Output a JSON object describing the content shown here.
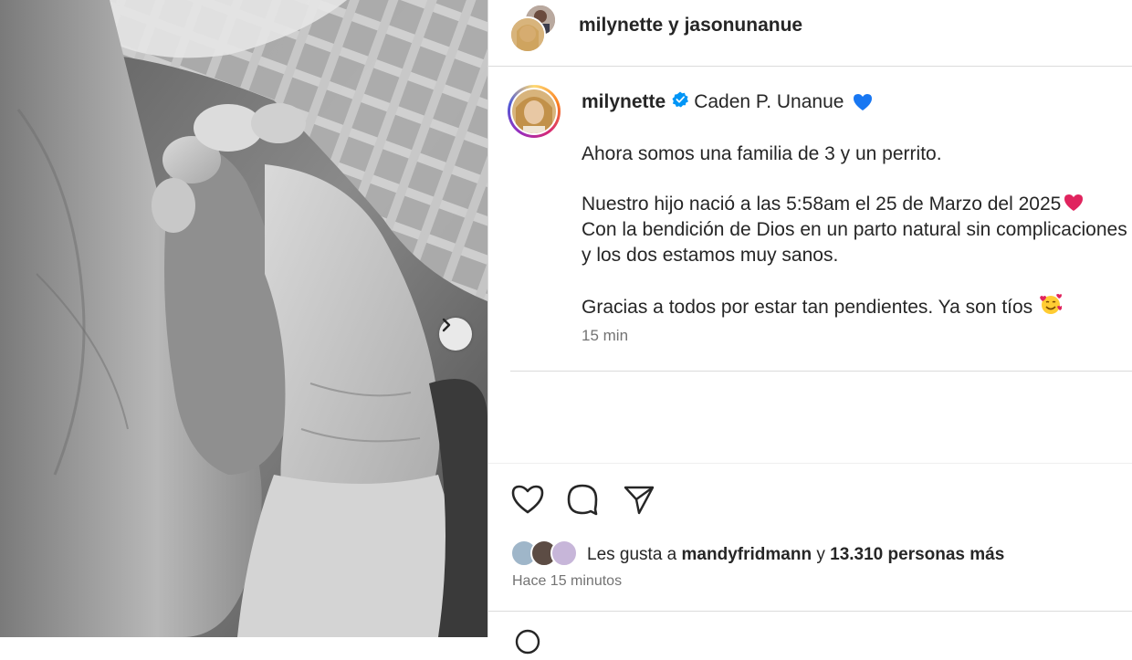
{
  "header": {
    "user1": "milynette",
    "joiner": " y ",
    "user2": "jasonunanue"
  },
  "caption": {
    "username": "milynette",
    "title": "Caden P. Unanue",
    "title_emoji": "💙",
    "lines": [
      "Ahora somos una familia de 3 y un perrito.",
      "Nuestro hijo nació a las 5:58am el 25 de Marzo del 2025",
      "Con la bendición de Dios en un parto natural sin complicaciones",
      "y los dos estamos muy sanos.",
      "Gracias a todos por estar tan pendientes. Ya son tíos"
    ],
    "line2_emoji": "❤️",
    "line5_emoji": "🥰",
    "timestamp": "15 min"
  },
  "likes": {
    "prefix": "Les gusta a ",
    "user": "mandyfridmann",
    "joiner": " y ",
    "count": "13.310 personas más"
  },
  "posted_ago": "Hace 15 minutos",
  "icons": {
    "like": "heart-icon",
    "comment": "comment-icon",
    "share": "send-icon",
    "next": "chevron-right-icon",
    "verified": "verified-badge-icon"
  },
  "colors": {
    "verified": "#0095f6",
    "text": "#262626",
    "secondary": "#737373",
    "heart_blue": "#1877f2",
    "heart_red": "#e0245e"
  }
}
